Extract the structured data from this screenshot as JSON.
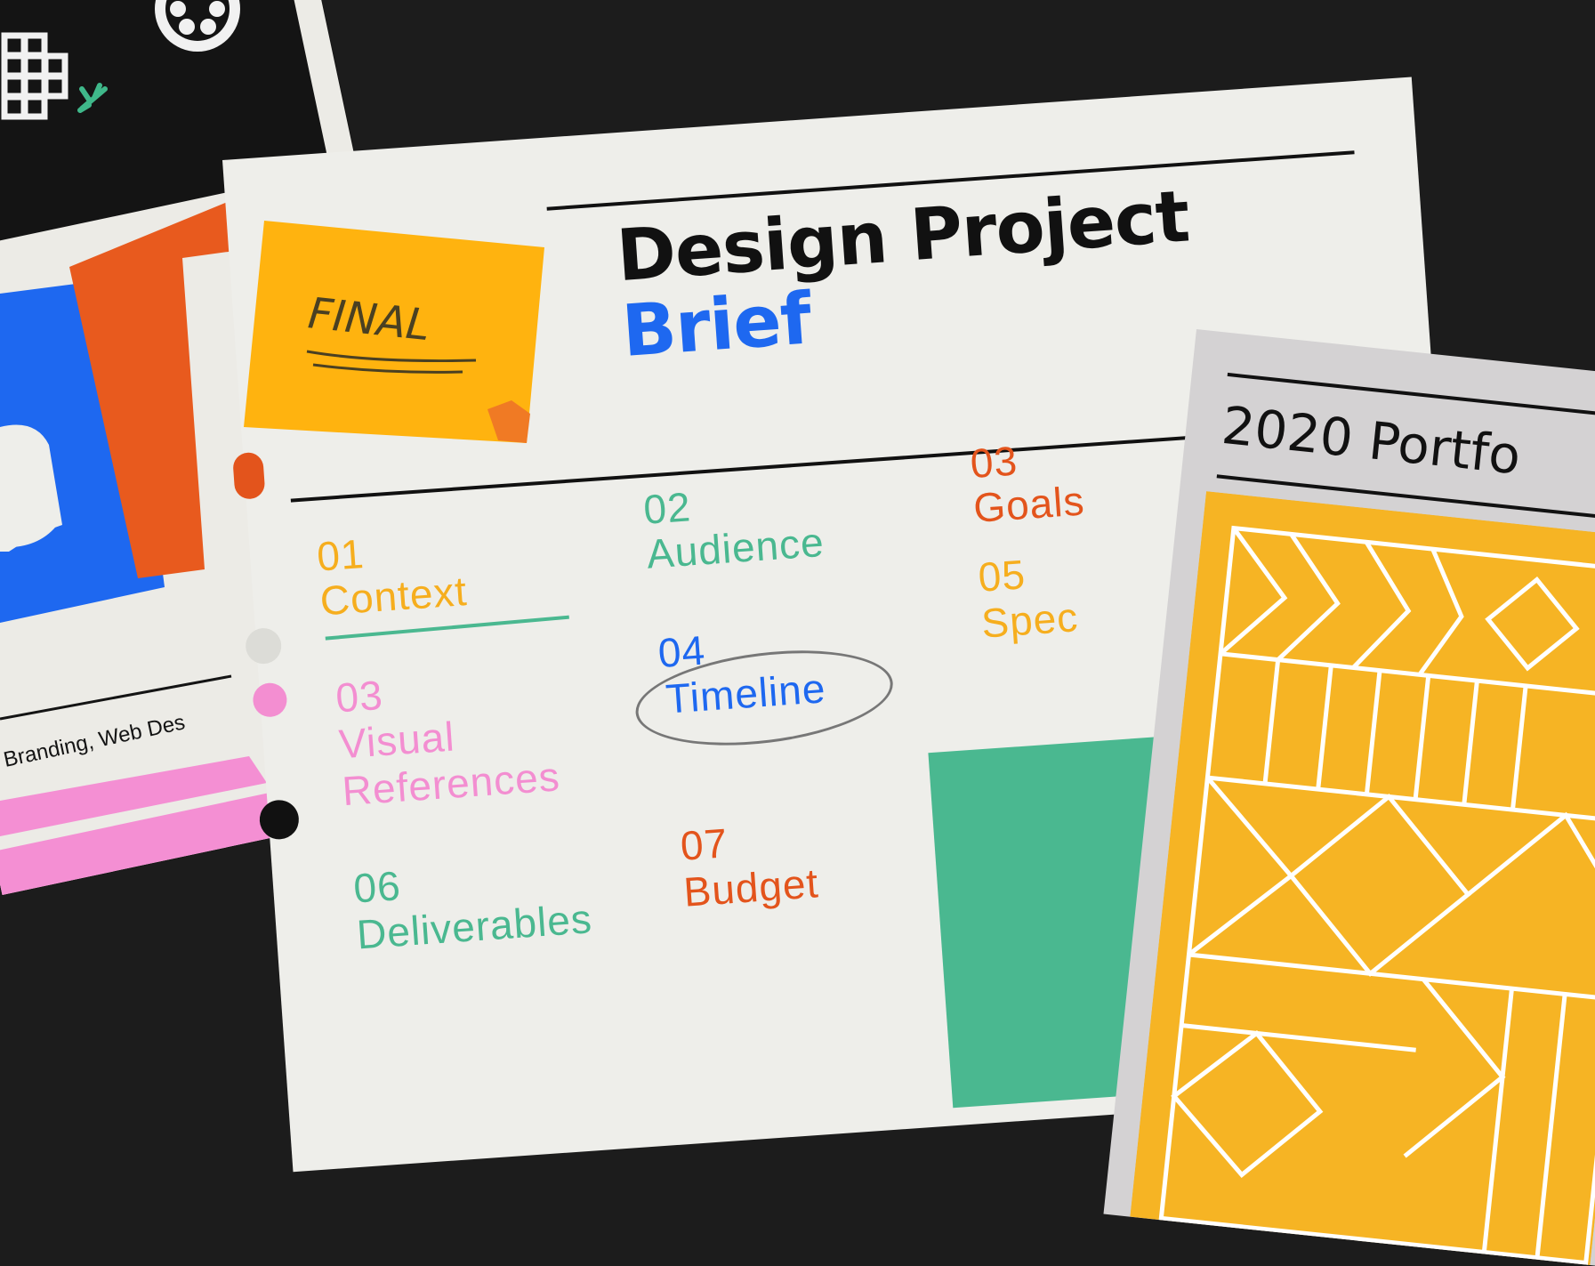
{
  "brief": {
    "title_line1": "Design Project",
    "title_line2": "Brief",
    "sticky_note": "FINAL",
    "topics": [
      {
        "num": "01",
        "label": "Context",
        "color": "#f6ae1e"
      },
      {
        "num": "02",
        "label": "Audience",
        "color": "#4ab890"
      },
      {
        "num": "03",
        "label": "Goals",
        "color": "#e3541c"
      },
      {
        "num": "03",
        "label": "Visual",
        "label2": "References",
        "color": "#f38ed1"
      },
      {
        "num": "04",
        "label": "Timeline",
        "color": "#1e68f0"
      },
      {
        "num": "05",
        "label": "Spec",
        "color": "#f6ae1e"
      },
      {
        "num": "06",
        "label": "Deliverables",
        "color": "#4ab890"
      },
      {
        "num": "07",
        "label": "Budget",
        "color": "#e3541c"
      }
    ]
  },
  "left_card": {
    "caption": "Branding, Web Des"
  },
  "portfolio": {
    "title": "2020 Portfo"
  },
  "colors": {
    "background": "#1c1c1c",
    "paper": "#eeeeea",
    "title_black": "#111111",
    "brief_blue": "#1e68f0",
    "sticky_yellow": "#ffb30f",
    "orange": "#e3541c",
    "green": "#4ab890",
    "pink": "#f38ed1",
    "portfolio_grey": "#d4d2d3",
    "portfolio_yellow": "#f6b424"
  }
}
